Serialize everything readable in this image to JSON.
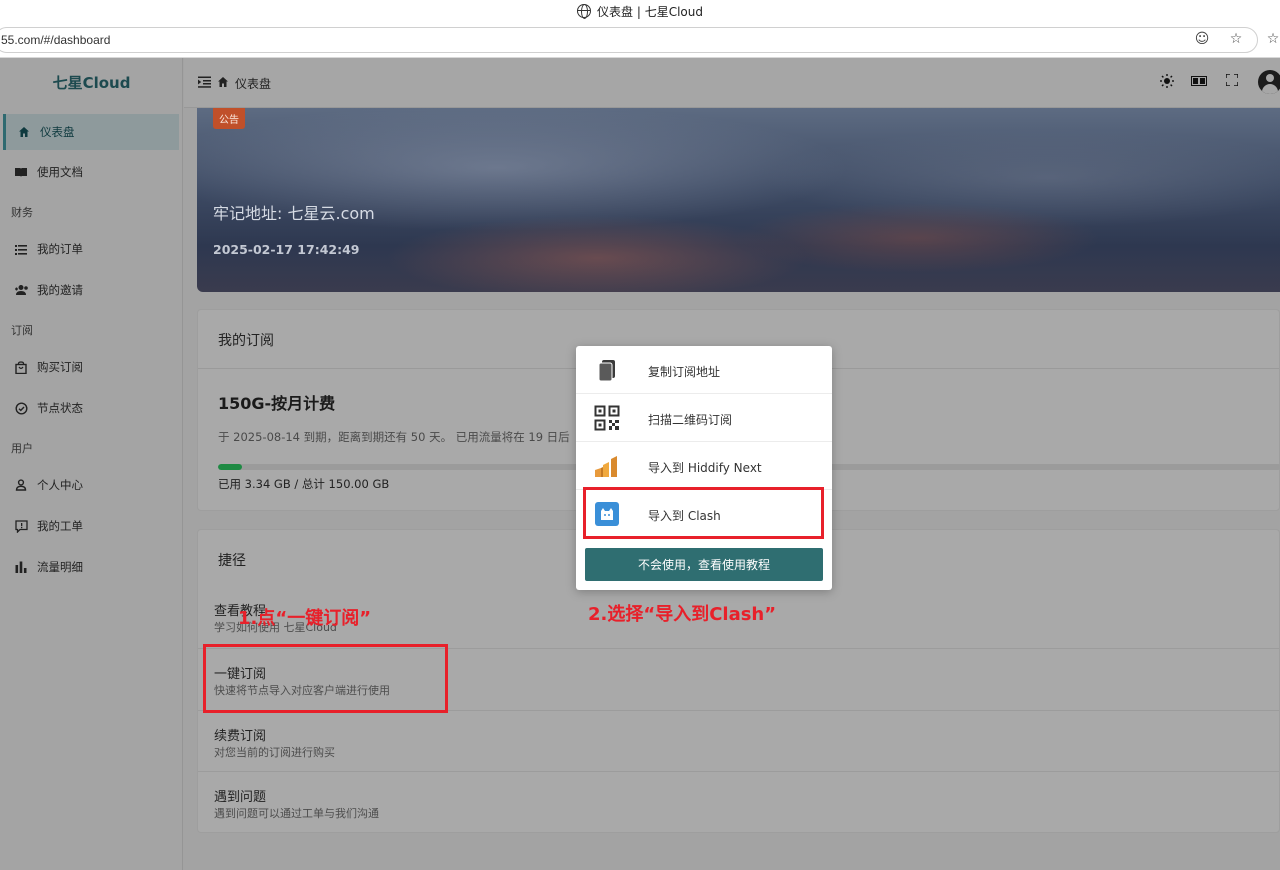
{
  "browser": {
    "window_title": "仪表盘 | 七星Cloud",
    "url": "55.com/#/dashboard"
  },
  "sidebar": {
    "brand": "七星Cloud",
    "items": [
      {
        "label": "仪表盘",
        "icon": "home-icon",
        "active": true
      },
      {
        "label": "使用文档",
        "icon": "book-icon"
      },
      {
        "group": "财务"
      },
      {
        "label": "我的订单",
        "icon": "list-icon"
      },
      {
        "label": "我的邀请",
        "icon": "people-icon"
      },
      {
        "group": "订阅"
      },
      {
        "label": "购买订阅",
        "icon": "bag-icon"
      },
      {
        "label": "节点状态",
        "icon": "check-circle-icon"
      },
      {
        "group": "用户"
      },
      {
        "label": "个人中心",
        "icon": "person-icon"
      },
      {
        "label": "我的工单",
        "icon": "ticket-icon"
      },
      {
        "label": "流量明细",
        "icon": "bar-chart-icon"
      }
    ]
  },
  "topbar": {
    "breadcrumb": "仪表盘",
    "icons": [
      "menu-toggle-icon",
      "theme-sun-icon",
      "language-icon",
      "fullscreen-icon",
      "avatar-icon"
    ]
  },
  "banner": {
    "badge": "公告",
    "title": "牢记地址: 七星云.com",
    "date": "2025-02-17 17:42:49"
  },
  "subscription": {
    "header": "我的订阅",
    "plan_name": "150G-按月计费",
    "expiry_text": "于 2025-08-14 到期，距离到期还有 50 天。 已用流量将在 19 日后",
    "used_fraction": 0.0223,
    "traffic_text": "已用 3.34 GB / 总计 150.00 GB",
    "progress_color": "#1e8a43"
  },
  "shortcuts": {
    "header": "捷径",
    "items": [
      {
        "title": "查看教程",
        "desc": "学习如何使用 七星Cloud"
      },
      {
        "title": "一键订阅",
        "desc": "快速将节点导入对应客户端进行使用"
      },
      {
        "title": "续费订阅",
        "desc": "对您当前的订阅进行购买"
      },
      {
        "title": "遇到问题",
        "desc": "遇到问题可以通过工单与我们沟通"
      }
    ]
  },
  "popup": {
    "items": [
      {
        "label": "复制订阅地址",
        "icon": "copy-icon"
      },
      {
        "label": "扫描二维码订阅",
        "icon": "qrcode-icon"
      },
      {
        "label": "导入到 Hiddify Next",
        "icon": "hiddify-icon"
      },
      {
        "label": "导入到 Clash",
        "icon": "clash-icon"
      }
    ],
    "button": "不会使用，查看使用教程",
    "button_color": "#2f6e71"
  },
  "annotations": {
    "step1": "1.点“一键订阅”",
    "step2": "2.选择“导入到Clash”",
    "color": "#e8202a"
  }
}
